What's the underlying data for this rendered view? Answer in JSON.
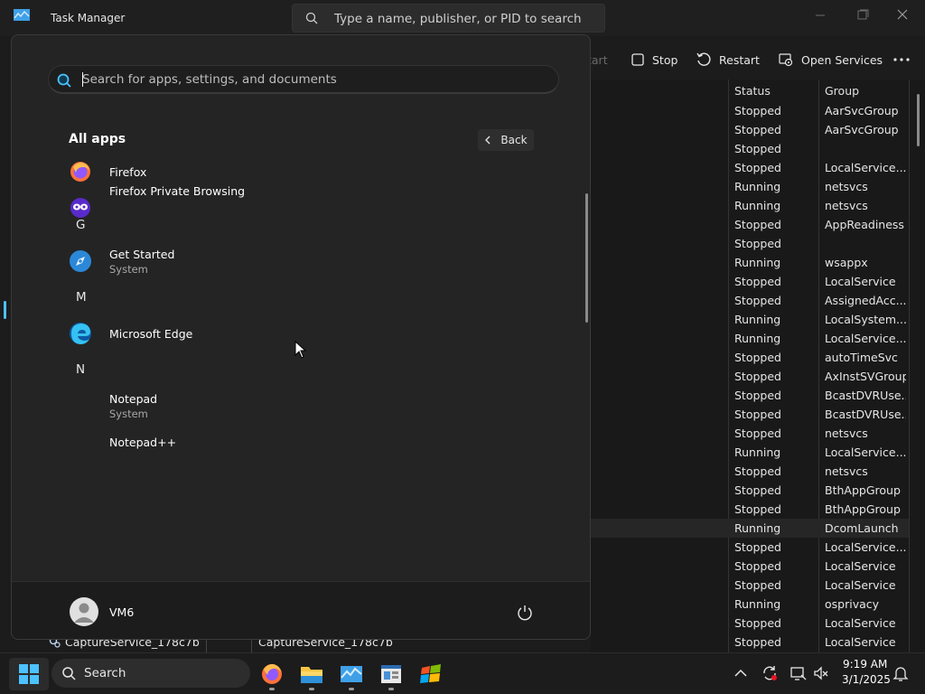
{
  "task_manager": {
    "title": "Task Manager",
    "search_placeholder": "Type a name, publisher, or PID to search",
    "toolbar": {
      "start_label": "tart",
      "stop_label": "Stop",
      "restart_label": "Restart",
      "open_services_label": "Open Services"
    },
    "columns": {
      "status": "Status",
      "group": "Group"
    },
    "rows": [
      {
        "status": "Stopped",
        "group": "AarSvcGroup"
      },
      {
        "status": "Stopped",
        "group": "AarSvcGroup"
      },
      {
        "status": "Stopped",
        "group": ""
      },
      {
        "status": "Stopped",
        "group": "LocalService..."
      },
      {
        "status": "Running",
        "group": "netsvcs"
      },
      {
        "status": "Running",
        "group": "netsvcs"
      },
      {
        "status": "Stopped",
        "group": "AppReadiness"
      },
      {
        "status": "Stopped",
        "group": ""
      },
      {
        "status": "Running",
        "group": "wsappx"
      },
      {
        "status": "Stopped",
        "group": "LocalService"
      },
      {
        "status": "Stopped",
        "group": "AssignedAcc..."
      },
      {
        "status": "Running",
        "group": "LocalSystem..."
      },
      {
        "status": "Running",
        "group": "LocalService..."
      },
      {
        "status": "Stopped",
        "group": "autoTimeSvc"
      },
      {
        "status": "Stopped",
        "group": "AxInstSVGroup"
      },
      {
        "status": "Stopped",
        "group": "BcastDVRUse..."
      },
      {
        "status": "Stopped",
        "group": "BcastDVRUse..."
      },
      {
        "status": "Stopped",
        "group": "netsvcs"
      },
      {
        "status": "Running",
        "group": "LocalService..."
      },
      {
        "status": "Stopped",
        "group": "netsvcs"
      },
      {
        "status": "Stopped",
        "group": "BthAppGroup"
      },
      {
        "status": "Stopped",
        "group": "BthAppGroup"
      },
      {
        "status": "Running",
        "group": "DcomLaunch"
      },
      {
        "status": "Stopped",
        "group": "LocalService..."
      },
      {
        "status": "Stopped",
        "group": "LocalService"
      },
      {
        "status": "Stopped",
        "group": "LocalService"
      },
      {
        "status": "Running",
        "group": "osprivacy"
      },
      {
        "status": "Stopped",
        "group": "LocalService"
      },
      {
        "status": "Stopped",
        "group": "LocalService"
      }
    ],
    "bottom_row": {
      "name1": "CaptureService_178c7b",
      "name2": "CaptureService_178c7b"
    }
  },
  "start_menu": {
    "search_placeholder": "Search for apps, settings, and documents",
    "section_title": "All apps",
    "back_label": "Back",
    "apps": {
      "firefox": "Firefox",
      "firefox_private": "Firefox Private Browsing",
      "letter_g": "G",
      "get_started": "Get Started",
      "get_started_sub": "System",
      "letter_m": "M",
      "edge": "Microsoft Edge",
      "letter_n": "N",
      "notepad": "Notepad",
      "notepad_sub": "System",
      "notepadpp": "Notepad++"
    },
    "user_name": "VM6"
  },
  "taskbar": {
    "search_label": "Search",
    "time": "9:19 AM",
    "date": "3/1/2025"
  },
  "colors": {
    "accent": "#4cc2ff",
    "background": "#1c1c1c",
    "start_menu_bg": "#242424"
  }
}
